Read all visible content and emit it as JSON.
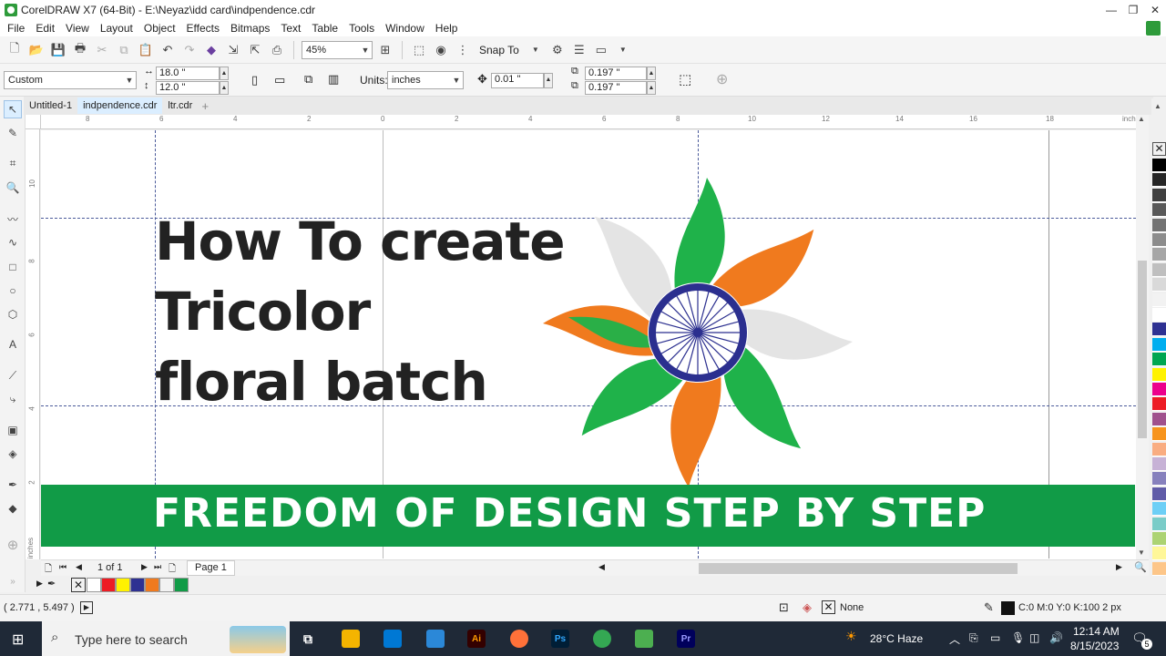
{
  "window": {
    "title": "CorelDRAW X7 (64-Bit) - E:\\Neyaz\\idd card\\indpendence.cdr",
    "controls": [
      "—",
      "❐",
      "✕"
    ]
  },
  "menu": [
    "File",
    "Edit",
    "View",
    "Layout",
    "Object",
    "Effects",
    "Bitmaps",
    "Text",
    "Table",
    "Tools",
    "Window",
    "Help"
  ],
  "toolbar": {
    "zoom": "45%",
    "snap_to": "Snap To"
  },
  "property_bar": {
    "page_preset": "Custom",
    "width": "18.0 \"",
    "height": "12.0 \"",
    "units_label": "Units:",
    "units_value": "inches",
    "nudge": "0.01 \"",
    "dup_x": "0.197 \"",
    "dup_y": "0.197 \""
  },
  "doc_tabs": [
    "Untitled-1",
    "indpendence.cdr",
    "ltr.cdr"
  ],
  "ruler": {
    "h_ticks": [
      "8",
      "6",
      "4",
      "2",
      "0",
      "2",
      "4",
      "6",
      "8",
      "10",
      "12",
      "14",
      "16",
      "18"
    ],
    "h_unit": "inches",
    "v_ticks": [
      "10",
      "8",
      "6",
      "4",
      "2"
    ],
    "v_unit": "inches"
  },
  "artwork": {
    "headline": [
      "How To create",
      "Tricolor",
      "floral batch"
    ],
    "banner": "FREEDOM OF DESIGN STEP BY STEP",
    "colors": {
      "saffron": "#f07a1e",
      "green": "#1fb24a",
      "grey_petal": "#e4e4e4",
      "chakra_blue": "#2b2f8f",
      "banner_green": "#119b47"
    }
  },
  "page_nav": {
    "counter": "1 of 1",
    "page_tab": "Page 1"
  },
  "status": {
    "coords": "( 2.771 , 5.497 )",
    "fill": "None",
    "outline": "C:0 M:0 Y:0 K:100  2 px"
  },
  "palette_colors": [
    "#000000",
    "#262626",
    "#404040",
    "#595959",
    "#737373",
    "#8c8c8c",
    "#a6a6a6",
    "#bfbfbf",
    "#d9d9d9",
    "#f2f2f2",
    "#ffffff",
    "#2e3192",
    "#00aeef",
    "#00a651",
    "#fff200",
    "#ec008c",
    "#ed1c24",
    "#a0518d",
    "#f7941d",
    "#f9ad81",
    "#c7b2d6",
    "#8781bd",
    "#605ca8",
    "#6dcff6",
    "#7accc8",
    "#acd373",
    "#fff799",
    "#fdc689"
  ],
  "doc_palette": [
    "#ffffff",
    "#ed1c24",
    "#fff200",
    "#2e3192",
    "#f07a1e",
    "#f2f2f2",
    "#119b47"
  ],
  "taskbar": {
    "search_placeholder": "Type here to search",
    "weather": "28°C  Haze",
    "time": "12:14 AM",
    "date": "8/15/2023",
    "notif_count": "5"
  }
}
